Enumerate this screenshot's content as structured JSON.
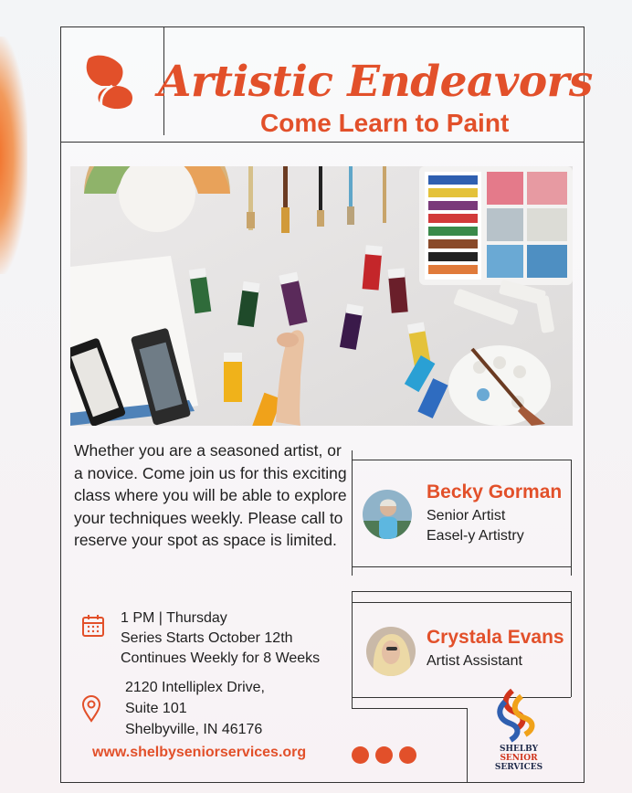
{
  "header": {
    "title": "Artistic Endeavors",
    "subtitle": "Come Learn to Paint"
  },
  "description": "Whether you are a seasoned artist, or a novice. Come join us for this exciting class where you will be able to explore your techniques weekly. Please call to reserve your spot as space is limited.",
  "schedule": {
    "icon": "calendar-icon",
    "lines": [
      "1 PM | Thursday",
      "Series Starts October 12th",
      "Continues Weekly for 8 Weeks"
    ]
  },
  "location": {
    "icon": "map-pin-icon",
    "lines": [
      "2120 Intelliplex Drive,",
      "Suite 101",
      "Shelbyville, IN 46176"
    ]
  },
  "instructors": [
    {
      "name": "Becky Gorman",
      "roles": [
        "Senior Artist",
        "Easel-y Artistry"
      ]
    },
    {
      "name": "Crystala Evans",
      "roles": [
        "Artist Assistant"
      ]
    }
  ],
  "website": "www.shelbyseniorservices.org",
  "footer_logo": {
    "lines": [
      "SHELBY",
      "SENIOR",
      "SERVICES"
    ]
  },
  "colors": {
    "accent": "#e2502a",
    "text": "#1f1f1f",
    "border": "#333333"
  }
}
